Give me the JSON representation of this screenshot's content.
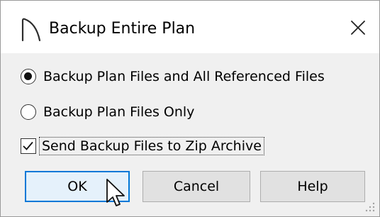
{
  "dialog": {
    "title": "Backup Entire Plan",
    "app_icon": "arc-icon",
    "close_icon": "close-icon"
  },
  "options": {
    "radio_all_label": "Backup Plan Files and All Referenced Files",
    "radio_all_checked": true,
    "radio_only_label": "Backup Plan Files Only",
    "radio_only_checked": false,
    "zip_label": "Send Backup Files to Zip Archive",
    "zip_checked": true
  },
  "buttons": {
    "ok": "OK",
    "cancel": "Cancel",
    "help": "Help"
  },
  "colors": {
    "default_button_border": "#0078d7",
    "default_button_bg": "#e5f1fb",
    "button_bg": "#e1e1e1",
    "dialog_bg": "#f0f0f0"
  }
}
